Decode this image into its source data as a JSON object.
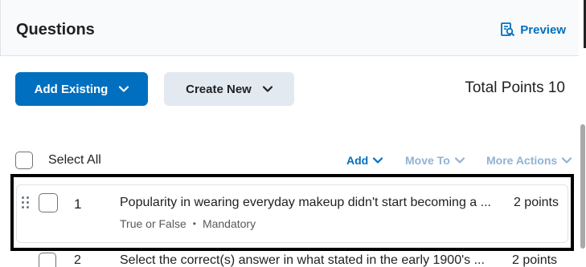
{
  "header": {
    "title": "Questions",
    "preview_label": "Preview"
  },
  "actions": {
    "add_existing_label": "Add Existing",
    "create_new_label": "Create New",
    "total_points_label": "Total Points 10"
  },
  "toolbar": {
    "select_all_label": "Select All",
    "add_label": "Add",
    "move_to_label": "Move To",
    "more_actions_label": "More Actions"
  },
  "questions": [
    {
      "number": "1",
      "title": "Popularity in wearing everyday makeup didn't start becoming a ...",
      "points": "2 points",
      "type": "True or False",
      "requirement": "Mandatory",
      "separator": "•"
    },
    {
      "number": "2",
      "title": "Select the correct(s) answer in what stated in the early 1900's ...",
      "points": "2 points"
    }
  ],
  "colors": {
    "accent": "#006fbf",
    "disabled": "#8fb3d3",
    "secondary_button": "#e3e9f1"
  }
}
